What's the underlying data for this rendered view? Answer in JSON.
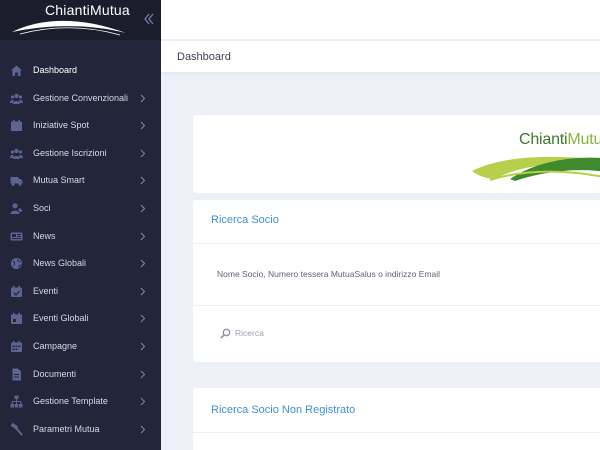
{
  "brand": {
    "name": "ChiantiMutua"
  },
  "sidebar": {
    "items": [
      {
        "label": "Dashboard",
        "icon": "home-icon",
        "active": true,
        "has_submenu": false
      },
      {
        "label": "Gestione Convenzionali",
        "icon": "users-icon",
        "has_submenu": true
      },
      {
        "label": "Iniziative Spot",
        "icon": "calendar-icon",
        "has_submenu": true
      },
      {
        "label": "Gestione Iscrizioni",
        "icon": "users-icon",
        "has_submenu": true
      },
      {
        "label": "Mutua Smart",
        "icon": "truck-icon",
        "has_submenu": true
      },
      {
        "label": "Soci",
        "icon": "user-edit-icon",
        "has_submenu": true
      },
      {
        "label": "News",
        "icon": "newspaper-icon",
        "has_submenu": true
      },
      {
        "label": "News Globali",
        "icon": "globe-icon",
        "has_submenu": true
      },
      {
        "label": "Eventi",
        "icon": "calendar-check-icon",
        "has_submenu": true
      },
      {
        "label": "Eventi Globali",
        "icon": "calendar-alt-icon",
        "has_submenu": true
      },
      {
        "label": "Campagne",
        "icon": "calendar-grid-icon",
        "has_submenu": true
      },
      {
        "label": "Documenti",
        "icon": "document-icon",
        "has_submenu": true
      },
      {
        "label": "Gestione Template",
        "icon": "sitemap-icon",
        "has_submenu": true
      },
      {
        "label": "Parametri Mutua",
        "icon": "hammer-icon",
        "has_submenu": true
      }
    ]
  },
  "header": {
    "title": "Dashboard"
  },
  "logo_card": {
    "logo_text_1": "Chianti",
    "logo_text_2": "Mutua"
  },
  "search_card": {
    "title": "Ricerca Socio",
    "hint": "Nome Socio, Numero tessera MutuaSalus o indirizzo Email",
    "placeholder": "Ricerca"
  },
  "unregistered_card": {
    "title": "Ricerca Socio Non Registrato"
  },
  "colors": {
    "sidebar_bg": "#23263a",
    "brand_bg": "#1b1d2d",
    "page_bg": "#eef0f7",
    "link_blue": "#3d8fd6",
    "logo_green": "#3a7a2a",
    "logo_lime": "#8cb43c"
  }
}
